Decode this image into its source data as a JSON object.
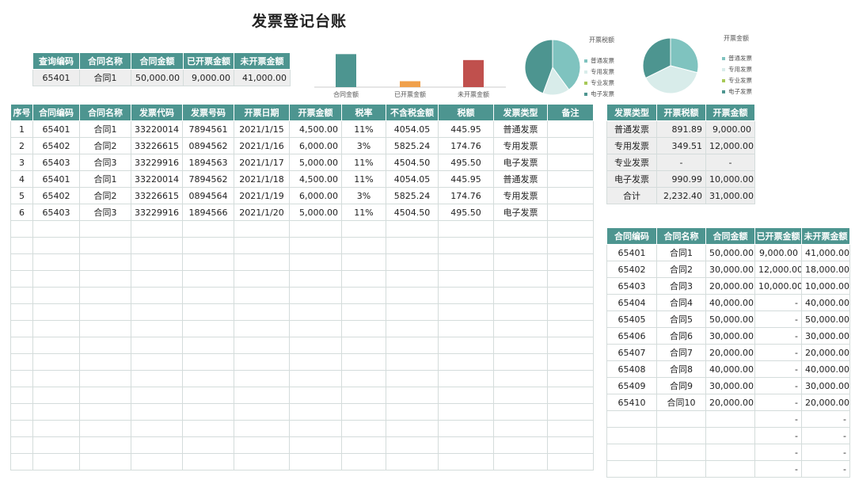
{
  "title": "发票登记台账",
  "query": {
    "headers": [
      "查询编码",
      "合同名称",
      "合同金额",
      "已开票金额",
      "未开票金额"
    ],
    "row": [
      "65401",
      "合同1",
      "50,000.00",
      "9,000.00",
      "41,000.00"
    ]
  },
  "main_table": {
    "headers": [
      "序号",
      "合同编码",
      "合同名称",
      "发票代码",
      "发票号码",
      "开票日期",
      "开票金额",
      "税率",
      "不含税金额",
      "税额",
      "发票类型",
      "备注"
    ],
    "rows": [
      [
        "1",
        "65401",
        "合同1",
        "33220014",
        "7894561",
        "2021/1/15",
        "4,500.00",
        "11%",
        "4054.05",
        "445.95",
        "普通发票",
        ""
      ],
      [
        "2",
        "65402",
        "合同2",
        "33226615",
        "0894562",
        "2021/1/16",
        "6,000.00",
        "3%",
        "5825.24",
        "174.76",
        "专用发票",
        ""
      ],
      [
        "3",
        "65403",
        "合同3",
        "33229916",
        "1894563",
        "2021/1/17",
        "5,000.00",
        "11%",
        "4504.50",
        "495.50",
        "电子发票",
        ""
      ],
      [
        "4",
        "65401",
        "合同1",
        "33220014",
        "7894562",
        "2021/1/18",
        "4,500.00",
        "11%",
        "4054.05",
        "445.95",
        "普通发票",
        ""
      ],
      [
        "5",
        "65402",
        "合同2",
        "33226615",
        "0894564",
        "2021/1/19",
        "6,000.00",
        "3%",
        "5825.24",
        "174.76",
        "专用发票",
        ""
      ],
      [
        "6",
        "65403",
        "合同3",
        "33229916",
        "1894566",
        "2021/1/20",
        "5,000.00",
        "11%",
        "4504.50",
        "495.50",
        "电子发票",
        ""
      ]
    ],
    "empty_rows": 15
  },
  "type_table": {
    "headers": [
      "发票类型",
      "开票税额",
      "开票金额"
    ],
    "rows": [
      [
        "普通发票",
        "891.89",
        "9,000.00"
      ],
      [
        "专用发票",
        "349.51",
        "12,000.00"
      ],
      [
        "专业发票",
        "-",
        "-"
      ],
      [
        "电子发票",
        "990.99",
        "10,000.00"
      ],
      [
        "合计",
        "2,232.40",
        "31,000.00"
      ]
    ]
  },
  "contract_table": {
    "headers": [
      "合同编码",
      "合同名称",
      "合同金额",
      "已开票金额",
      "未开票金额"
    ],
    "rows": [
      [
        "65401",
        "合同1",
        "50,000.00",
        "9,000.00",
        "41,000.00"
      ],
      [
        "65402",
        "合同2",
        "30,000.00",
        "12,000.00",
        "18,000.00"
      ],
      [
        "65403",
        "合同3",
        "20,000.00",
        "10,000.00",
        "10,000.00"
      ],
      [
        "65404",
        "合同4",
        "40,000.00",
        "-",
        "40,000.00"
      ],
      [
        "65405",
        "合同5",
        "50,000.00",
        "-",
        "50,000.00"
      ],
      [
        "65406",
        "合同6",
        "30,000.00",
        "-",
        "30,000.00"
      ],
      [
        "65407",
        "合同7",
        "20,000.00",
        "-",
        "20,000.00"
      ],
      [
        "65408",
        "合同8",
        "40,000.00",
        "-",
        "40,000.00"
      ],
      [
        "65409",
        "合同9",
        "30,000.00",
        "-",
        "30,000.00"
      ],
      [
        "65410",
        "合同10",
        "20,000.00",
        "-",
        "20,000.00"
      ],
      [
        "",
        "",
        "",
        "-",
        "-"
      ],
      [
        "",
        "",
        "",
        "-",
        "-"
      ],
      [
        "",
        "",
        "",
        "-",
        "-"
      ],
      [
        "",
        "",
        "",
        "-",
        "-"
      ]
    ]
  },
  "chart_data": [
    {
      "type": "bar",
      "categories": [
        "合同金额",
        "已开票金额",
        "未开票金额"
      ],
      "values": [
        50000,
        9000,
        41000
      ],
      "colors": [
        "#4d9590",
        "#f0a04b",
        "#c0504d"
      ],
      "ylim": [
        0,
        60000
      ]
    },
    {
      "type": "pie",
      "title": "开票税额",
      "labels": [
        "普通发票",
        "专用发票",
        "专业发票",
        "电子发票"
      ],
      "values": [
        891.89,
        349.51,
        0,
        990.99
      ],
      "colors": [
        "#7fc3bf",
        "#d8ecea",
        "#a7c957",
        "#4d9590"
      ]
    },
    {
      "type": "pie",
      "title": "开票金额",
      "labels": [
        "普通发票",
        "专用发票",
        "专业发票",
        "电子发票"
      ],
      "values": [
        9000,
        12000,
        0,
        10000
      ],
      "colors": [
        "#7fc3bf",
        "#d8ecea",
        "#a7c957",
        "#4d9590"
      ]
    }
  ]
}
